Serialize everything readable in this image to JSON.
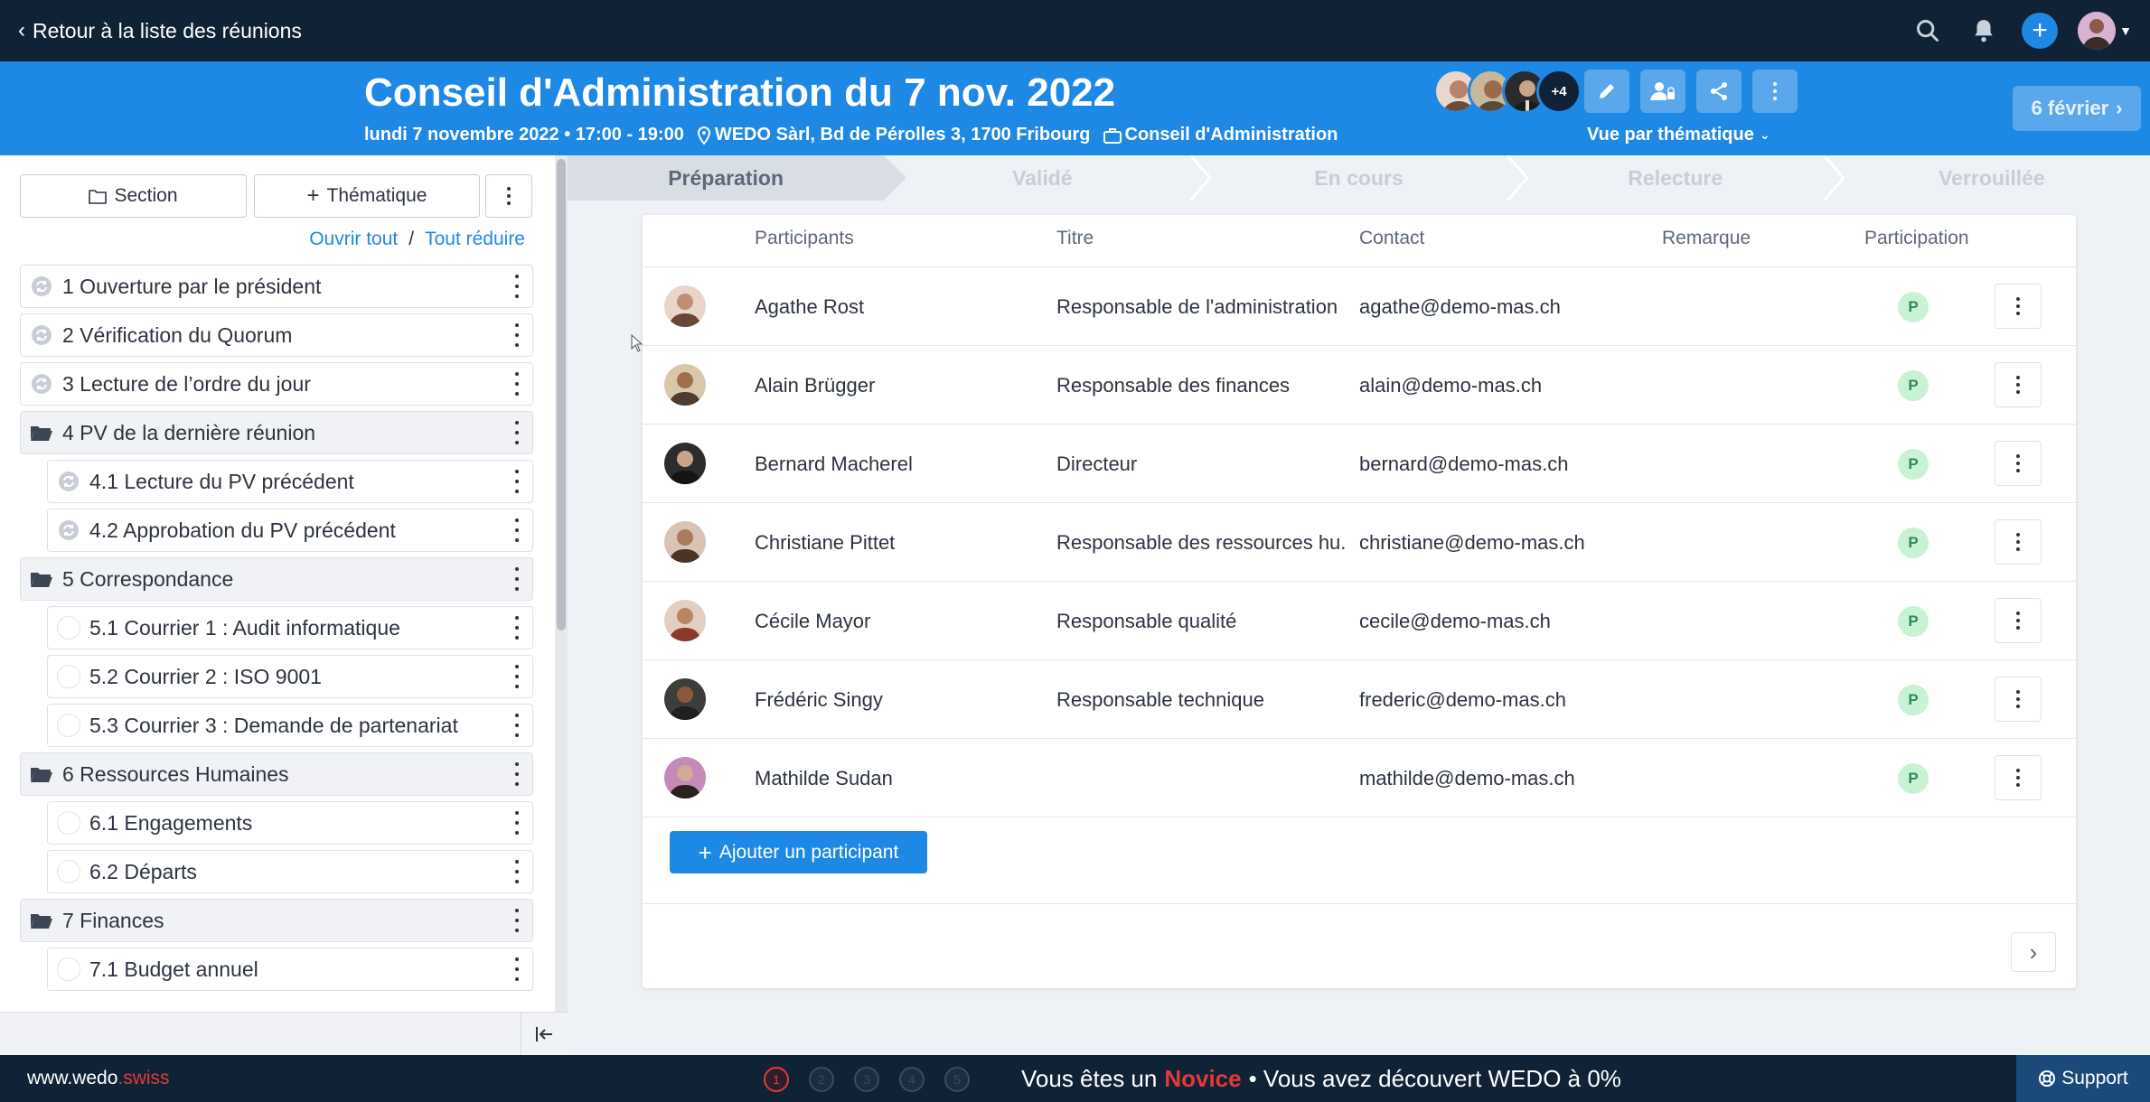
{
  "topbar": {
    "back_label": "Retour à la liste des réunions"
  },
  "meeting": {
    "title": "Conseil d'Administration du 7 nov. 2022",
    "datetime": "lundi 7 novembre 2022 • 17:00 - 19:00",
    "location": "WEDO Sàrl, Bd de Pérolles 3, 1700 Fribourg",
    "category": "Conseil d'Administration",
    "more_participants": "+4",
    "view_label": "Vue par thématique",
    "next_meeting_label": "6 février"
  },
  "left_panel": {
    "section_btn": "Section",
    "thematic_btn": "Thématique",
    "open_all": "Ouvrir tout",
    "separator": "/",
    "collapse_all": "Tout réduire",
    "items": [
      {
        "label": "1 Ouverture par le président",
        "kind": "topic"
      },
      {
        "label": "2 Vérification du Quorum",
        "kind": "topic"
      },
      {
        "label": "3 Lecture de l’ordre du jour",
        "kind": "topic"
      },
      {
        "label": "4 PV de la dernière réunion",
        "kind": "folder"
      },
      {
        "label": "4.1 Lecture du PV précédent",
        "kind": "sub-topic"
      },
      {
        "label": "4.2 Approbation du PV précédent",
        "kind": "sub-topic"
      },
      {
        "label": "5 Correspondance",
        "kind": "folder"
      },
      {
        "label": "5.1 Courrier 1 : Audit informatique",
        "kind": "sub-empty"
      },
      {
        "label": "5.2 Courrier 2 : ISO 9001",
        "kind": "sub-empty"
      },
      {
        "label": "5.3 Courrier 3 : Demande de partenariat",
        "kind": "sub-empty"
      },
      {
        "label": "6 Ressources Humaines",
        "kind": "folder"
      },
      {
        "label": "6.1 Engagements",
        "kind": "sub-empty"
      },
      {
        "label": "6.2 Départs",
        "kind": "sub-empty"
      },
      {
        "label": "7 Finances",
        "kind": "folder"
      },
      {
        "label": "7.1 Budget annuel",
        "kind": "sub-empty"
      }
    ]
  },
  "stepper": {
    "steps": [
      "Préparation",
      "Validé",
      "En cours",
      "Relecture",
      "Verrouillée"
    ],
    "active_index": 0
  },
  "participants": {
    "headers": {
      "name": "Participants",
      "title": "Titre",
      "contact": "Contact",
      "remark": "Remarque",
      "participation": "Participation"
    },
    "rows": [
      {
        "name": "Agathe Rost",
        "title": "Responsable de l'administration",
        "contact": "agathe@demo-mas.ch",
        "remark": "",
        "participation": "P"
      },
      {
        "name": "Alain Brügger",
        "title": "Responsable des finances",
        "contact": "alain@demo-mas.ch",
        "remark": "",
        "participation": "P"
      },
      {
        "name": "Bernard Macherel",
        "title": "Directeur",
        "contact": "bernard@demo-mas.ch",
        "remark": "",
        "participation": "P"
      },
      {
        "name": "Christiane Pittet",
        "title": "Responsable des ressources hu...",
        "contact": "christiane@demo-mas.ch",
        "remark": "",
        "participation": "P"
      },
      {
        "name": "Cécile Mayor",
        "title": "Responsable qualité",
        "contact": "cecile@demo-mas.ch",
        "remark": "",
        "participation": "P"
      },
      {
        "name": "Frédéric Singy",
        "title": "Responsable technique",
        "contact": "frederic@demo-mas.ch",
        "remark": "",
        "participation": "P"
      },
      {
        "name": "Mathilde Sudan",
        "title": "",
        "contact": "mathilde@demo-mas.ch",
        "remark": "",
        "participation": "P"
      }
    ],
    "add_label": "Ajouter un participant"
  },
  "footer": {
    "site_prefix": "www.wedo",
    "site_suffix": ".swiss",
    "levels": [
      "1",
      "2",
      "3",
      "4",
      "5"
    ],
    "active_level": 0,
    "progress_prefix": "Vous êtes un",
    "level_name": "Novice",
    "progress_suffix": "• Vous avez découvert WEDO à 0%",
    "support_label": "Support"
  },
  "colors": {
    "navy": "#0f2236",
    "primary": "#1e88e5",
    "accent_red": "#e53935",
    "badge_green": "#c8f2d4"
  }
}
